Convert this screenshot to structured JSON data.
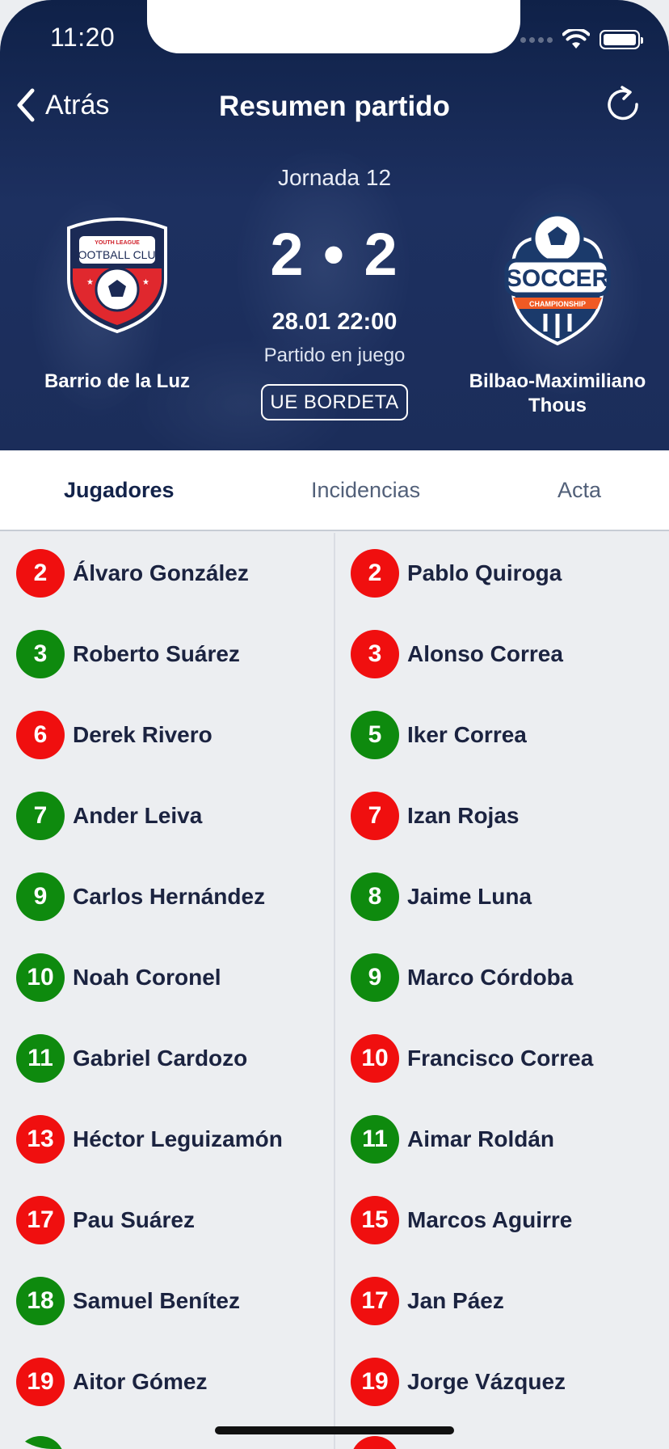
{
  "status": {
    "time": "11:20"
  },
  "nav": {
    "back_label": "Atrás",
    "title": "Resumen partido"
  },
  "match": {
    "round": "Jornada 12",
    "score": "2 • 2",
    "datetime": "28.01 22:00",
    "status": "Partido en juego",
    "venue": "UE BORDETA",
    "home_team": {
      "name": "Barrio de la Luz",
      "logo_text_top": "YOUTH LEAGUE",
      "logo_text": "FOOTBALL CLUB"
    },
    "away_team": {
      "name": "Bilbao-Maximiliano Thous",
      "logo_text": "SOCCER",
      "logo_ribbon": "CHAMPIONSHIP"
    }
  },
  "tabs": [
    {
      "label": "Jugadores",
      "active": true
    },
    {
      "label": "Incidencias",
      "active": false
    },
    {
      "label": "Acta",
      "active": false
    }
  ],
  "colors": {
    "header": "#1b2d5a",
    "red": "#f00f0f",
    "green": "#0e8a0e"
  },
  "home_players": [
    {
      "number": "2",
      "name": "Álvaro González",
      "color": "red"
    },
    {
      "number": "3",
      "name": "Roberto Suárez",
      "color": "green"
    },
    {
      "number": "6",
      "name": "Derek Rivero",
      "color": "red"
    },
    {
      "number": "7",
      "name": "Ander Leiva",
      "color": "green"
    },
    {
      "number": "9",
      "name": "Carlos Hernández",
      "color": "green"
    },
    {
      "number": "10",
      "name": "Noah Coronel",
      "color": "green"
    },
    {
      "number": "11",
      "name": "Gabriel Cardozo",
      "color": "green"
    },
    {
      "number": "13",
      "name": "Héctor Leguizamón",
      "color": "red"
    },
    {
      "number": "17",
      "name": "Pau Suárez",
      "color": "red"
    },
    {
      "number": "18",
      "name": "Samuel Benítez",
      "color": "green"
    },
    {
      "number": "19",
      "name": "Aitor Gómez",
      "color": "red"
    }
  ],
  "away_players": [
    {
      "number": "2",
      "name": "Pablo Quiroga",
      "color": "red"
    },
    {
      "number": "3",
      "name": "Alonso Correa",
      "color": "red"
    },
    {
      "number": "5",
      "name": "Iker Correa",
      "color": "green"
    },
    {
      "number": "7",
      "name": "Izan Rojas",
      "color": "red"
    },
    {
      "number": "8",
      "name": "Jaime Luna",
      "color": "green"
    },
    {
      "number": "9",
      "name": "Marco Córdoba",
      "color": "green"
    },
    {
      "number": "10",
      "name": "Francisco Correa",
      "color": "red"
    },
    {
      "number": "11",
      "name": "Aimar Roldán",
      "color": "green"
    },
    {
      "number": "15",
      "name": "Marcos Aguirre",
      "color": "red"
    },
    {
      "number": "17",
      "name": "Jan Páez",
      "color": "red"
    },
    {
      "number": "19",
      "name": "Jorge Vázquez",
      "color": "red"
    }
  ]
}
